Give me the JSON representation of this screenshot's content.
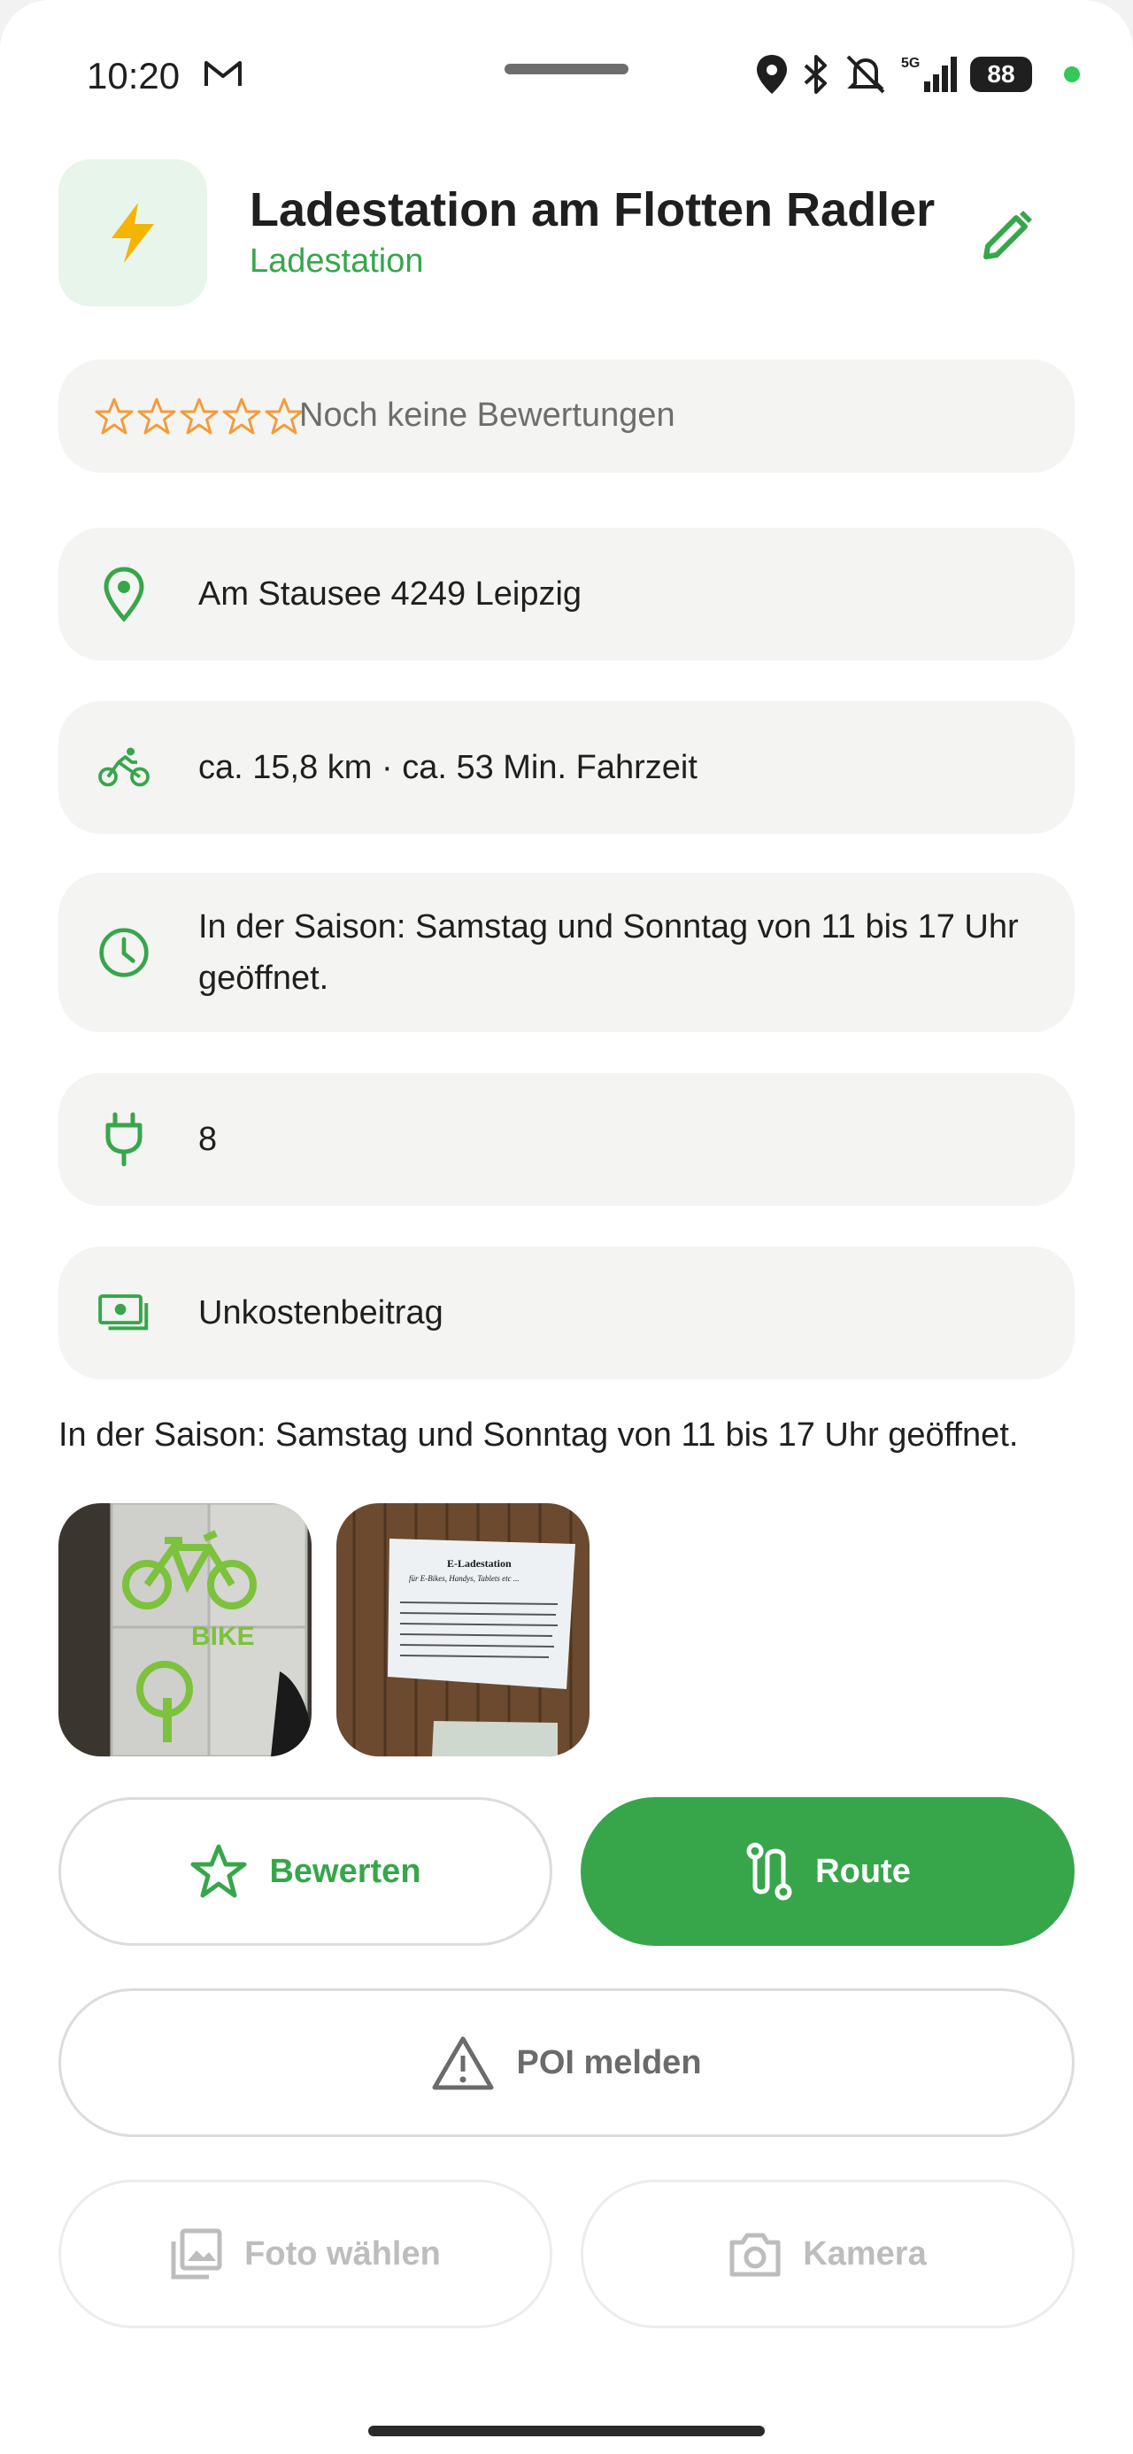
{
  "status_bar": {
    "time": "10:20",
    "network": "5G",
    "battery": "88"
  },
  "header": {
    "icon": "lightning-icon",
    "title": "Ladestation am Flotten Radler",
    "category": "Ladestation"
  },
  "rating": {
    "stars": "☆☆☆☆☆",
    "text": "Noch keine Bewertungen"
  },
  "details": {
    "address": "Am Stausee 4249 Leipzig",
    "distance": "ca. 15,8 km · ca. 53 Min. Fahrzeit",
    "opening_hours": "In der Saison: Samstag und Sonntag von 11 bis 17 Uhr geöffnet.",
    "sockets": "8",
    "fee": "Unkostenbeitrag"
  },
  "description": "In der Saison: Samstag und Sonntag von 11 bis 17 Uhr geöffnet.",
  "photos": {
    "photo1_text": "BIKE",
    "photo2_title": "E-Ladestation",
    "photo2_subtitle": "für E-Bikes, Handys, Tablets etc ..."
  },
  "buttons": {
    "rate": "Bewerten",
    "route": "Route",
    "report": "POI melden",
    "choose_photo": "Foto wählen",
    "camera": "Kamera"
  },
  "colors": {
    "accent": "#37a64b",
    "card_bg": "#f4f4f2",
    "star": "#f39c3c"
  }
}
